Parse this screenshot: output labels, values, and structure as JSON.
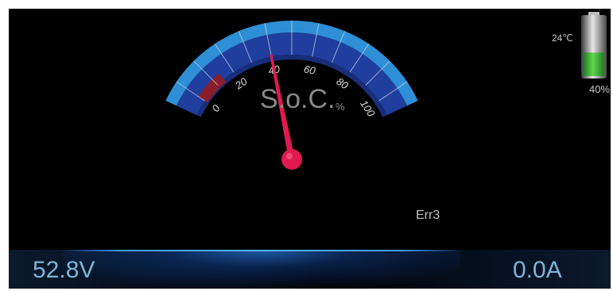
{
  "gauge": {
    "title": "S.o.C.",
    "unit": "%",
    "value": 40,
    "min": 0,
    "max": 100,
    "tick_labels": [
      "0",
      "20",
      "40",
      "60",
      "80",
      "100"
    ],
    "colors": {
      "outer_band": "#2e8fd6",
      "inner_band": "#1f3e9e",
      "inner_band_dark": "#182e7a",
      "low_zone": "#8a1e2a",
      "needle": "#e01a4f",
      "ticks": "#cfd8ea",
      "tick_labels": "#d8d8d8"
    }
  },
  "battery": {
    "temperature": "24℃",
    "percent_label": "40%",
    "level": 0.4,
    "fill_color": "#35b238"
  },
  "status": {
    "error_code": "Err3"
  },
  "readouts": {
    "voltage": "52.8V",
    "current": "0.0A",
    "color": "#7fb3d6"
  }
}
